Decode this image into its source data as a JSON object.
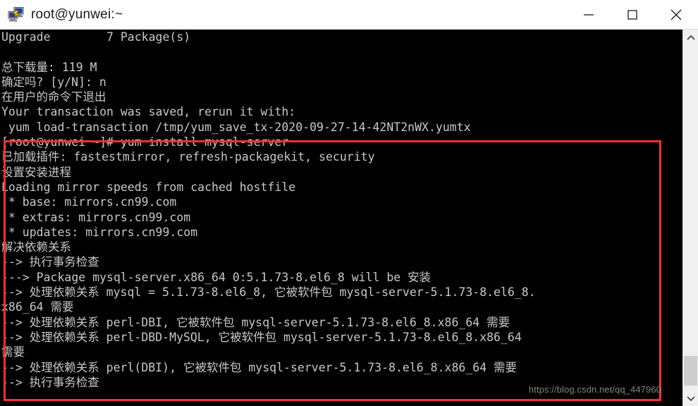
{
  "window": {
    "title": "root@yunwei:~",
    "icon": "putty-icon",
    "controls": {
      "minimize": "minimize-button",
      "maximize": "maximize-button",
      "close": "close-button"
    }
  },
  "terminal": {
    "background_color": "#000000",
    "text_color": "#c8c8c8",
    "lines": [
      "Upgrade        7 Package(s)",
      "",
      "总下载量: 119 M",
      "确定吗? [y/N]: n",
      "在用户的命令下退出",
      "Your transaction was saved, rerun it with:",
      " yum load-transaction /tmp/yum_save_tx-2020-09-27-14-42NT2nWX.yumtx",
      "[root@yunwei ~]# yum install mysql-server",
      "已加载插件: fastestmirror, refresh-packagekit, security",
      "设置安装进程",
      "Loading mirror speeds from cached hostfile",
      " * base: mirrors.cn99.com",
      " * extras: mirrors.cn99.com",
      " * updates: mirrors.cn99.com",
      "解决依赖关系",
      "--> 执行事务检查",
      "---> Package mysql-server.x86_64 0:5.1.73-8.el6_8 will be 安装",
      "--> 处理依赖关系 mysql = 5.1.73-8.el6_8, 它被软件包 mysql-server-5.1.73-8.el6_8.",
      "x86_64 需要",
      "--> 处理依赖关系 perl-DBI, 它被软件包 mysql-server-5.1.73-8.el6_8.x86_64 需要",
      "--> 处理依赖关系 perl-DBD-MySQL, 它被软件包 mysql-server-5.1.73-8.el6_8.x86_64",
      "需要",
      "--> 处理依赖关系 perl(DBI), 它被软件包 mysql-server-5.1.73-8.el6_8.x86_64 需要",
      "--> 执行事务检查"
    ]
  },
  "annotation": {
    "type": "red-rectangle",
    "color": "#fc3030"
  },
  "watermark": {
    "text": "https://blog.csdn.net/qq_447960",
    "color": "#8d8d8d"
  },
  "scrollbar": {
    "up_arrow": "scroll-up-arrow",
    "down_arrow": "scroll-down-arrow",
    "thumb": "scroll-thumb"
  }
}
